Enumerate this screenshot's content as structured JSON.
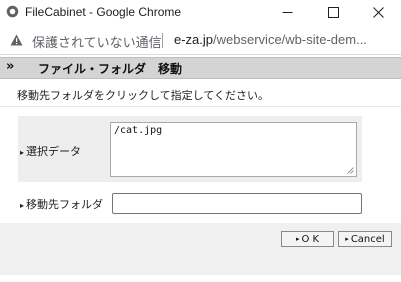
{
  "window": {
    "title": "FileCabinet - Google Chrome",
    "address": {
      "not_secure_label": "保護されていない通信",
      "url_host": "e-za.jp",
      "url_path": "/webservice/wb-site-dem..."
    }
  },
  "dialog": {
    "header_arrows": "»",
    "header_title": "ファイル・フォルダ　移動",
    "instruction": "移動先フォルダをクリックして指定してください。",
    "fields": {
      "selected_data_label": "選択データ",
      "selected_data_value": "/cat.jpg",
      "destination_label": "移動先フォルダ",
      "destination_value": ""
    },
    "label_marker": "▸",
    "buttons": {
      "ok_label": "O K",
      "cancel_label": "Cancel",
      "marker": "▸"
    }
  }
}
